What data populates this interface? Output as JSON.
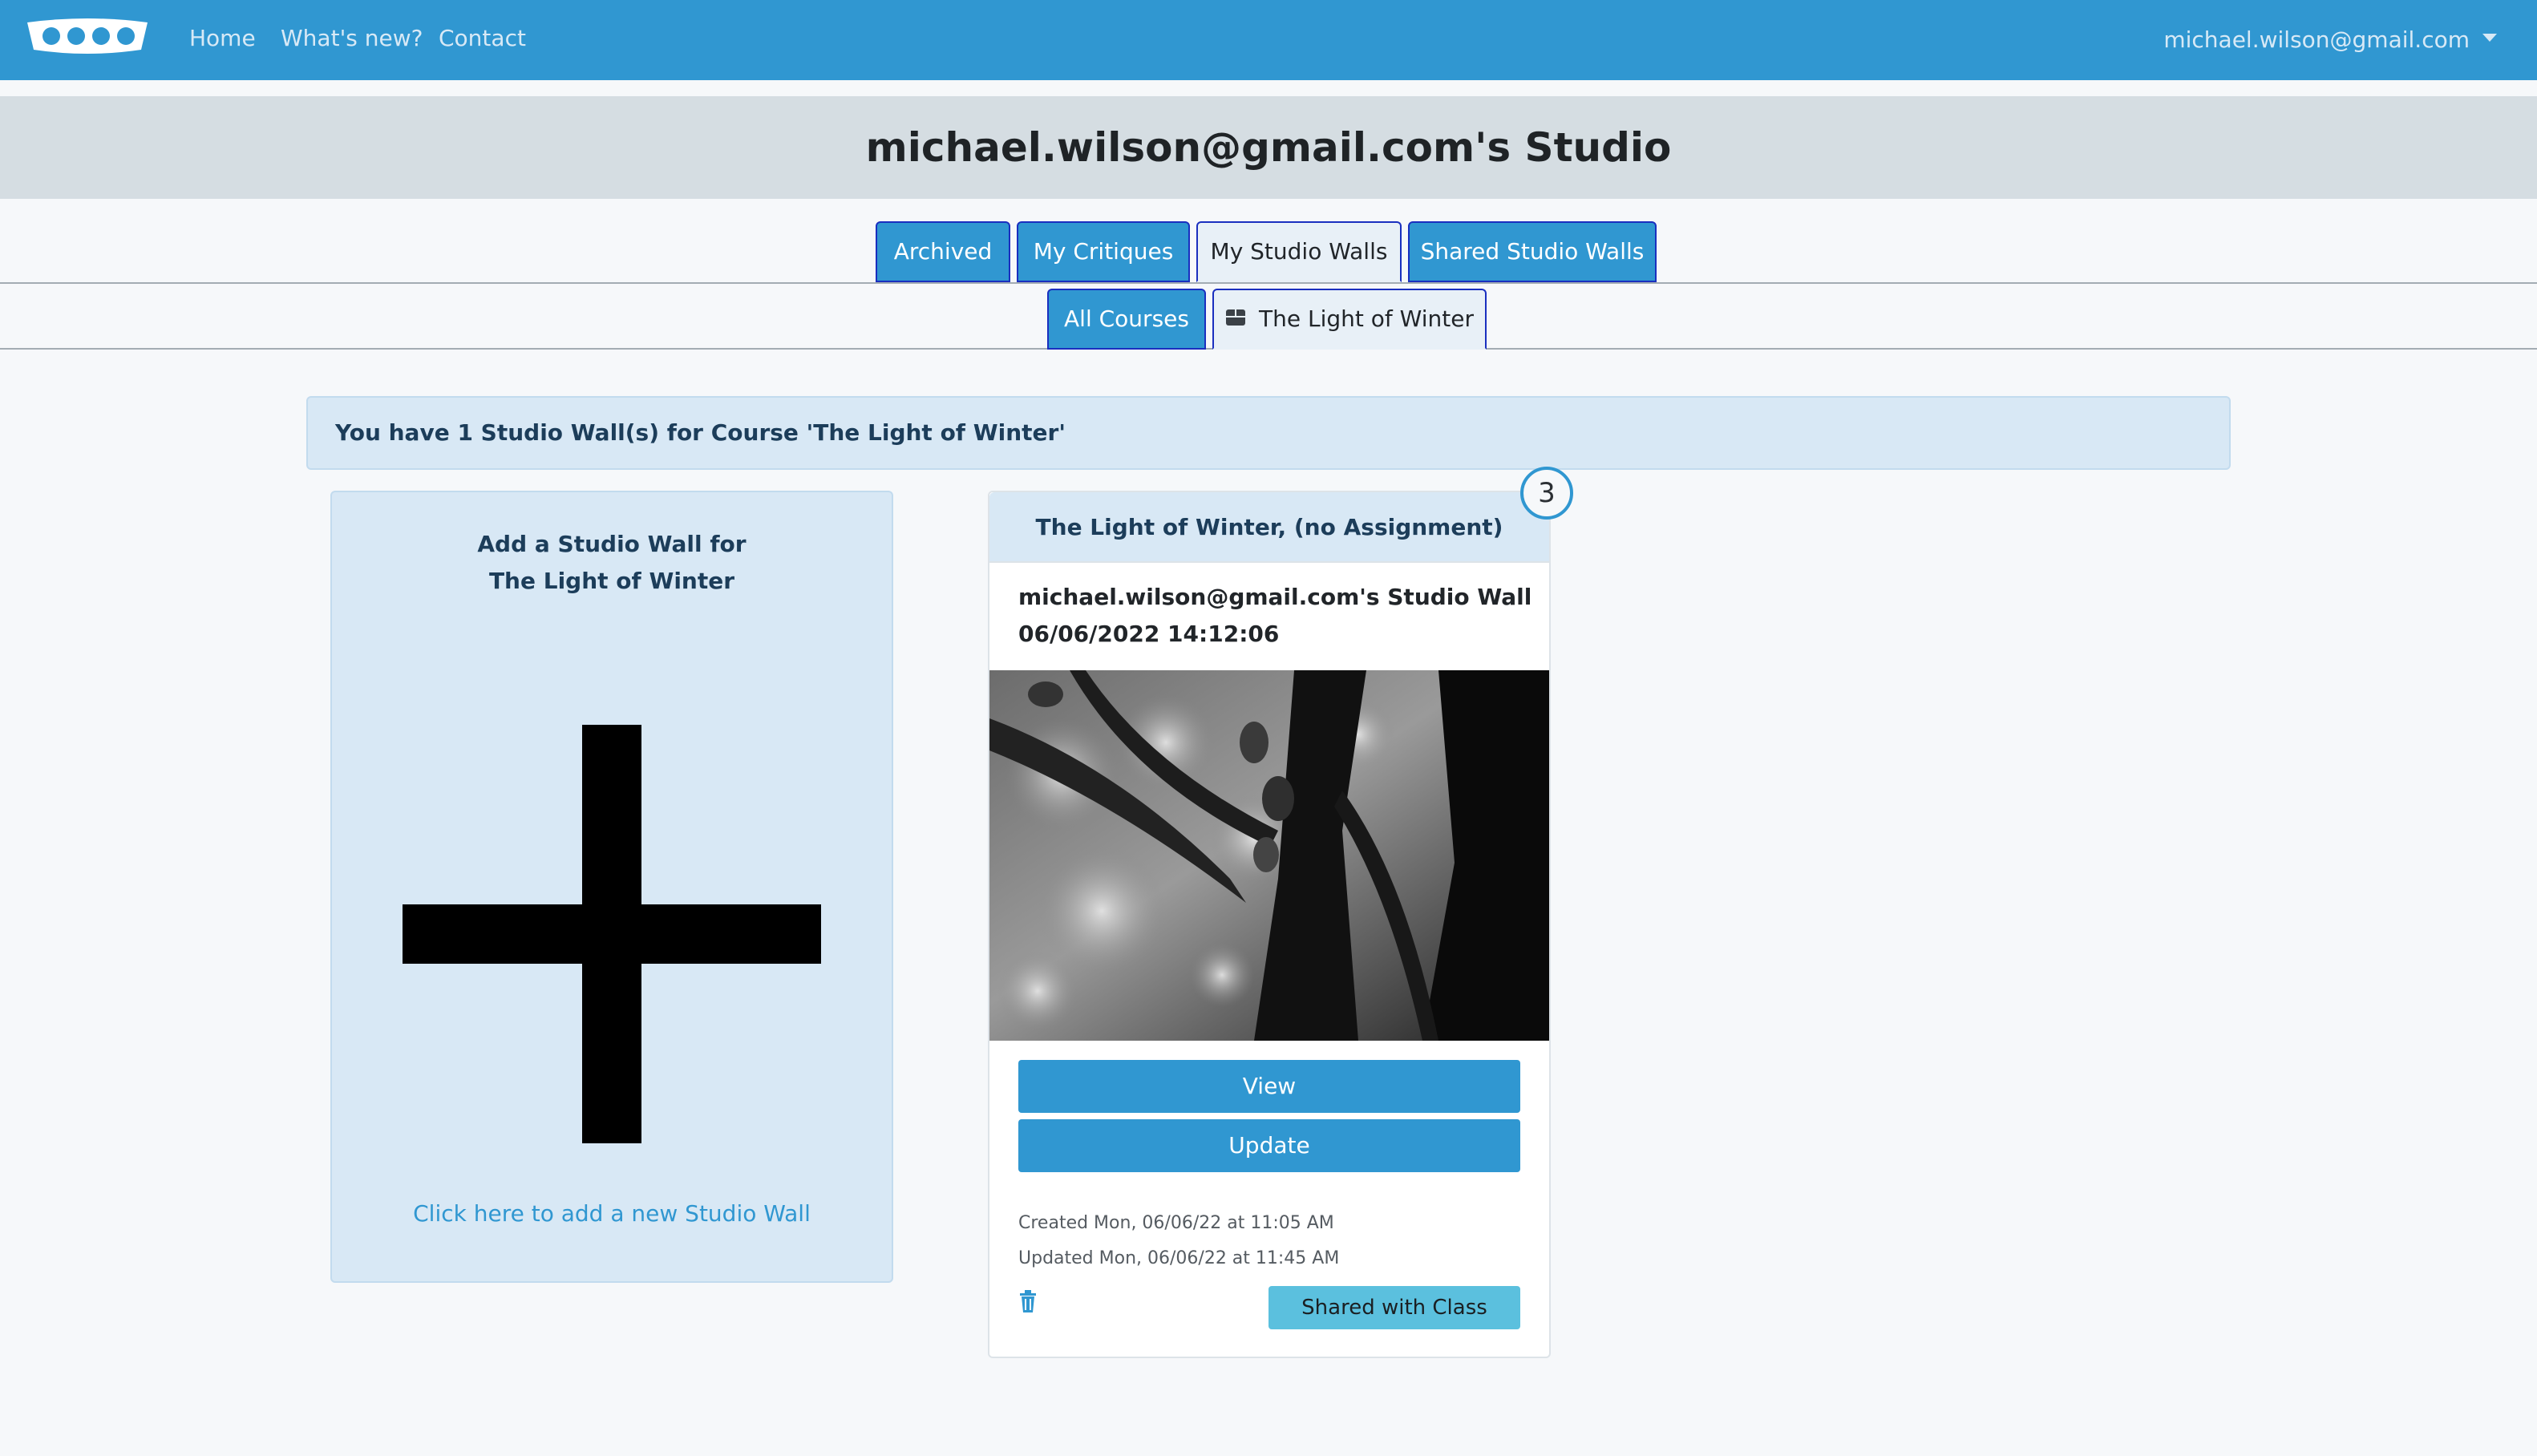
{
  "nav": {
    "links": [
      "Home",
      "What's new?",
      "Contact"
    ],
    "user_email": "michael.wilson@gmail.com"
  },
  "header": {
    "title": "michael.wilson@gmail.com's Studio"
  },
  "tabs": {
    "primary": [
      "Archived",
      "My Critiques",
      "My Studio Walls",
      "Shared Studio Walls"
    ],
    "secondary": [
      "All Courses",
      "The Light of Winter"
    ]
  },
  "alert": {
    "text": "You have 1 Studio Wall(s) for Course 'The Light of Winter'"
  },
  "add_card": {
    "title_line1": "Add a Studio Wall for",
    "title_line2": "The Light of Winter",
    "link": "Click here to add a new Studio Wall"
  },
  "wall_card": {
    "header": "The Light of Winter, (no Assignment)",
    "badge_count": "3",
    "owner": "michael.wilson@gmail.com's Studio Wall",
    "date": "06/06/2022 14:12:06",
    "view_label": "View",
    "update_label": "Update",
    "created": "Created Mon, 06/06/22 at 11:05 AM",
    "updated": "Updated Mon, 06/06/22 at 11:45 AM",
    "shared_label": "Shared with Class"
  },
  "colors": {
    "navbar": "#3097d1",
    "header_bg": "#d5dde2",
    "card_bg": "#d8e8f5",
    "shared_badge": "#5bc0de"
  },
  "icons": [
    "logo",
    "caret-down-icon",
    "course-icon",
    "trash-icon"
  ]
}
